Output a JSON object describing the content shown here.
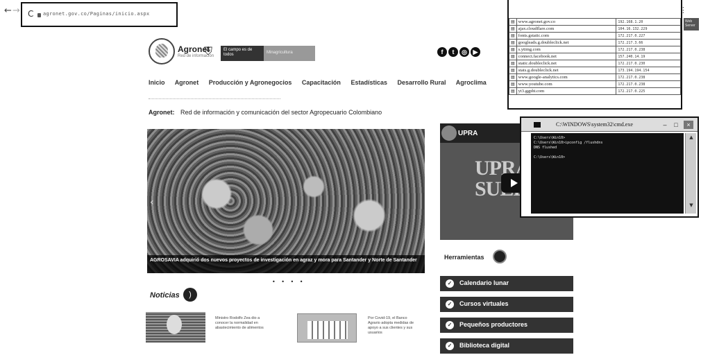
{
  "browser": {
    "back": "←",
    "forward": "→",
    "reload": "C",
    "url": "agronet.gov.co/Paginas/inicio.aspx",
    "toolbar_icons": "☆ ⚲ ⋮"
  },
  "header": {
    "logo_text": "Agronet",
    "logo_sub": "Red de información",
    "gov_banner_1": "El campo es de todos",
    "gov_banner_2": "Minagricultura",
    "social": [
      "f",
      "t",
      "◎",
      "▶"
    ]
  },
  "menu": {
    "items": [
      "Inicio",
      "Agronet",
      "Producción y Agronegocios",
      "Capacitación",
      "Estadísticas",
      "Desarrollo Rural",
      "Agroclima"
    ]
  },
  "tagline": {
    "bold": "Agronet:",
    "text": "Red de información y comunicación del sector Agropecuario Colombiano"
  },
  "hero": {
    "caption": "AGROSAVIA adquirió dos nuevos proyectos de investigación en agraz y mora para Santander y Norte de Santander",
    "dots": "• • • •"
  },
  "news": {
    "title": "Noticias",
    "item1": "Ministro Rodolfo Zea dio a conocer la normalidad en abastecimiento de alimentos",
    "item2": "Por Covid-19, el Banco Agrario adopta medidas de apoyo a sus clientes y sus usuarios"
  },
  "video": {
    "brand": "UPRA",
    "text_line1": "UPRA",
    "text_line2": "SUELO"
  },
  "tools": {
    "title": "Herramientas",
    "items": [
      "Calendario lunar",
      "Cursos virtuales",
      "Pequeños productores",
      "Biblioteca digital"
    ]
  },
  "hosts": {
    "rows": [
      {
        "host": "www.agronet.gov.co",
        "ip": "192.168.1.20"
      },
      {
        "host": "ajax.cloudflare.com",
        "ip": "104.16.132.229"
      },
      {
        "host": "fonts.gstatic.com",
        "ip": "172.217.0.227"
      },
      {
        "host": "googleads.g.doubleclick.net",
        "ip": "172.217.3.66"
      },
      {
        "host": "s.ytimg.com",
        "ip": "172.217.0.238"
      },
      {
        "host": "connect.facebook.net",
        "ip": "157.240.14.19"
      },
      {
        "host": "static.doubleclick.net",
        "ip": "172.217.0.230"
      },
      {
        "host": "stats.g.doubleclick.net",
        "ip": "173.194.194.154"
      },
      {
        "host": "www.google-analytics.com",
        "ip": "172.217.0.238"
      },
      {
        "host": "www.youtube.com",
        "ip": "172.217.0.238"
      },
      {
        "host": "yt3.ggpht.com",
        "ip": "172.217.0.225"
      }
    ],
    "side_tab": "Web Server"
  },
  "cmd": {
    "title": "C:\\WINDOWS\\system32\\cmd.exe",
    "min": "–",
    "max": "□",
    "close": "×",
    "console": "C:\\Users\\Win10>\nC:\\Users\\Win10>ipconfig /flushdns\nDNS flushed\n\nC:\\Users\\Win10>"
  }
}
